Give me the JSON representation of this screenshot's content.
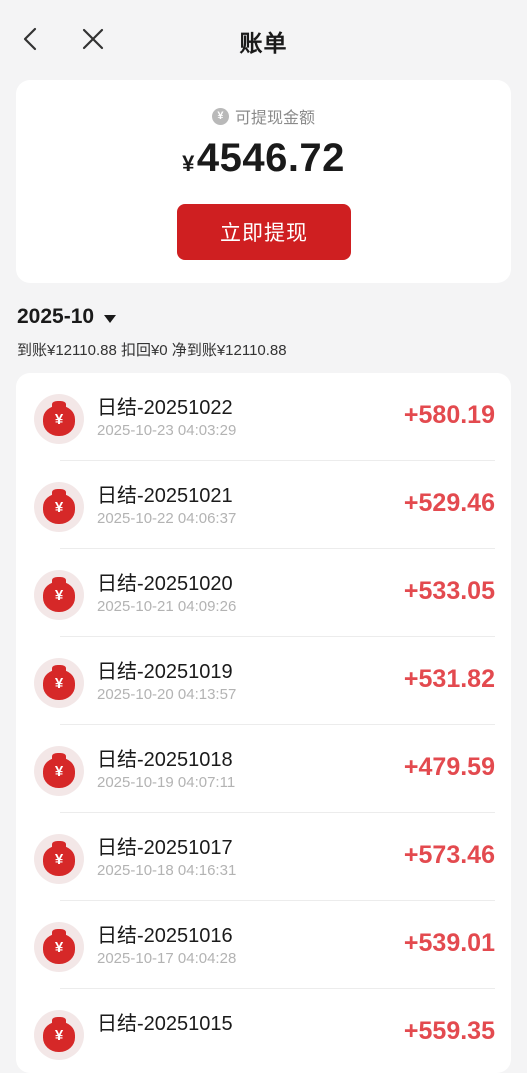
{
  "nav": {
    "title": "账单"
  },
  "balance": {
    "label": "可提现金额",
    "coin_symbol": "¥",
    "currency": "¥",
    "amount": "4546.72",
    "withdraw_label": "立即提现"
  },
  "period": {
    "month": "2025-10",
    "summary": "到账¥12110.88  扣回¥0  净到账¥12110.88"
  },
  "accent_color": "#cf1f21",
  "amount_color": "#e34a4f",
  "transactions": [
    {
      "name": "日结-20251022",
      "time": "2025-10-23 04:03:29",
      "amount": "+580.19",
      "icon_symbol": "¥"
    },
    {
      "name": "日结-20251021",
      "time": "2025-10-22 04:06:37",
      "amount": "+529.46",
      "icon_symbol": "¥"
    },
    {
      "name": "日结-20251020",
      "time": "2025-10-21 04:09:26",
      "amount": "+533.05",
      "icon_symbol": "¥"
    },
    {
      "name": "日结-20251019",
      "time": "2025-10-20 04:13:57",
      "amount": "+531.82",
      "icon_symbol": "¥"
    },
    {
      "name": "日结-20251018",
      "time": "2025-10-19 04:07:11",
      "amount": "+479.59",
      "icon_symbol": "¥"
    },
    {
      "name": "日结-20251017",
      "time": "2025-10-18 04:16:31",
      "amount": "+573.46",
      "icon_symbol": "¥"
    },
    {
      "name": "日结-20251016",
      "time": "2025-10-17 04:04:28",
      "amount": "+539.01",
      "icon_symbol": "¥"
    },
    {
      "name": "日结-20251015",
      "time": "",
      "amount": "+559.35",
      "icon_symbol": "¥"
    }
  ]
}
